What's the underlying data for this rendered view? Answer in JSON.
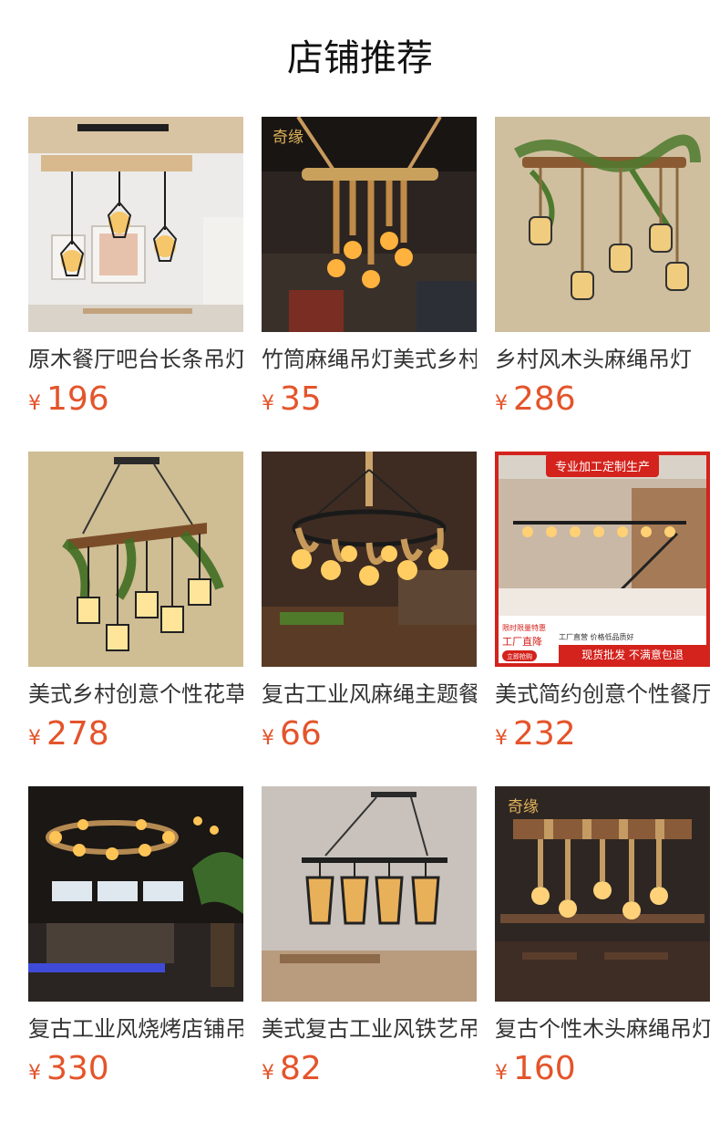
{
  "section": {
    "title": "店铺推荐"
  },
  "products": [
    {
      "name": "原木餐厅吧台长条吊灯",
      "currency": "¥",
      "price": "196",
      "image": "wood-beam-cage-pendant-lamp"
    },
    {
      "name": "竹筒麻绳吊灯美式乡村",
      "currency": "¥",
      "price": "35",
      "image": "bamboo-rope-pendant-lamp",
      "logo": "奇缘"
    },
    {
      "name": "乡村风木头麻绳吊灯",
      "currency": "¥",
      "price": "286",
      "image": "vine-wood-rope-pendant-lamp"
    },
    {
      "name": "美式乡村创意个性花草吊灯",
      "currency": "¥",
      "price": "278",
      "image": "leaf-wood-cage-pendant-lamp"
    },
    {
      "name": "复古工业风麻绳主题餐厅吊灯",
      "currency": "¥",
      "price": "66",
      "image": "round-rope-chandelier"
    },
    {
      "name": "美式简约创意个性餐厅吊灯",
      "currency": "¥",
      "price": "232",
      "image": "linear-bulb-pendant-lamp",
      "banner": "专业加工定制生产",
      "promo": {
        "limited": "限时限量特惠",
        "factory": "工厂直降",
        "button": "立即抢购",
        "note": "工厂直营 价格低品质好",
        "tagline": "现货批发 不满意包退"
      }
    },
    {
      "name": "复古工业风烧烤店铺吊灯",
      "currency": "¥",
      "price": "330",
      "image": "industrial-bbq-restaurant-chandelier"
    },
    {
      "name": "美式复古工业风铁艺吊灯",
      "currency": "¥",
      "price": "82",
      "image": "iron-cage-linear-pendant-lamp"
    },
    {
      "name": "复古个性木头麻绳吊灯",
      "currency": "¥",
      "price": "160",
      "image": "wood-rope-bulb-pendant-lamp",
      "logo": "奇缘"
    }
  ]
}
